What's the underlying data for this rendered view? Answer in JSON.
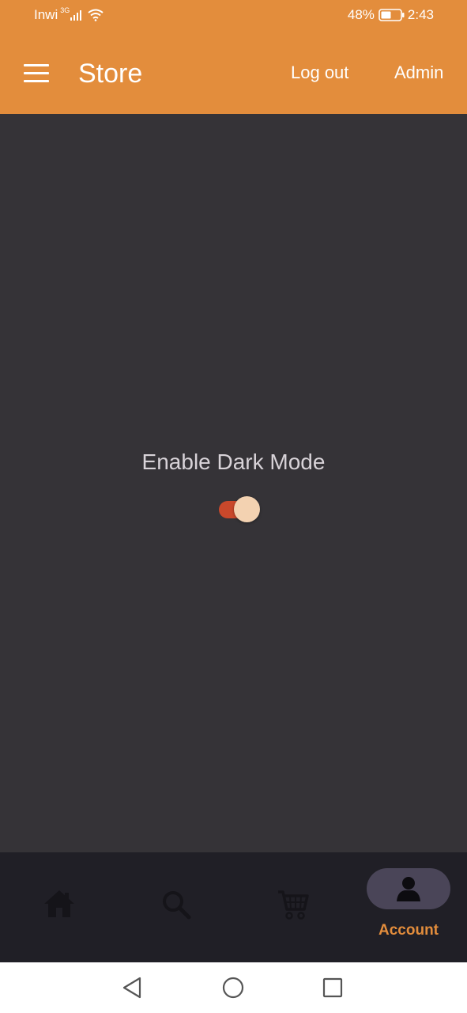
{
  "status_bar": {
    "carrier": "Inwi",
    "network": "3G",
    "battery": "48%",
    "time": "2:43"
  },
  "app_bar": {
    "title": "Store",
    "logout_label": "Log out",
    "admin_label": "Admin"
  },
  "settings": {
    "dark_mode_label": "Enable Dark Mode",
    "dark_mode_enabled": true
  },
  "bottom_nav": {
    "items": [
      {
        "icon": "home-icon"
      },
      {
        "icon": "search-icon"
      },
      {
        "icon": "cart-icon"
      },
      {
        "icon": "account-icon",
        "label": "Account",
        "active": true
      }
    ]
  },
  "colors": {
    "accent": "#E38D3C",
    "background": "#353337",
    "nav_background": "#201F26",
    "toggle_track": "#C9482B",
    "toggle_thumb": "#F3D2B1"
  }
}
